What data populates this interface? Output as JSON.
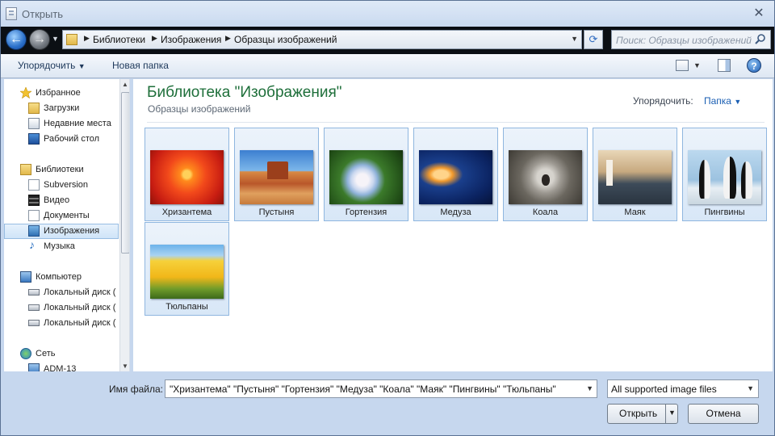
{
  "window": {
    "title": "Открыть"
  },
  "address": {
    "segments": [
      "Библиотеки",
      "Изображения",
      "Образцы изображений"
    ]
  },
  "search": {
    "placeholder": "Поиск: Образцы изображений"
  },
  "toolbar": {
    "organize_label": "Упорядочить",
    "new_folder_label": "Новая папка"
  },
  "nav": {
    "favorites": {
      "label": "Избранное",
      "items": [
        "Загрузки",
        "Недавние места",
        "Рабочий стол"
      ]
    },
    "libraries": {
      "label": "Библиотеки",
      "items": [
        "Subversion",
        "Видео",
        "Документы",
        "Изображения",
        "Музыка"
      ],
      "selected": "Изображения"
    },
    "computer": {
      "label": "Компьютер",
      "items": [
        "Локальный диск (",
        "Локальный диск (",
        "Локальный диск ("
      ]
    },
    "network": {
      "label": "Сеть",
      "items": [
        "ADM-13"
      ]
    }
  },
  "content": {
    "library_title": "Библиотека \"Изображения\"",
    "library_subtitle": "Образцы изображений",
    "arrange_label": "Упорядочить:",
    "arrange_value": "Папка",
    "items": [
      {
        "name": "Хризантема",
        "image": "chrysanthemum"
      },
      {
        "name": "Пустыня",
        "image": "desert"
      },
      {
        "name": "Гортензия",
        "image": "hydrangeas"
      },
      {
        "name": "Медуза",
        "image": "jellyfish"
      },
      {
        "name": "Коала",
        "image": "koala"
      },
      {
        "name": "Маяк",
        "image": "lighthouse"
      },
      {
        "name": "Пингвины",
        "image": "penguins"
      },
      {
        "name": "Тюльпаны",
        "image": "tulips"
      }
    ]
  },
  "footer": {
    "filename_label": "Имя файла:",
    "filename_value": "\"Хризантема\" \"Пустыня\" \"Гортензия\" \"Медуза\" \"Коала\" \"Маяк\" \"Пингвины\" \"Тюльпаны\"",
    "filter_value": "All supported image files",
    "open_label": "Открыть",
    "cancel_label": "Отмена"
  },
  "colors": {
    "accent_title": "#1e6f3a",
    "link_blue": "#1b5fb3",
    "selection_fill": "#d8e7f7",
    "selection_border": "#8fb6df"
  }
}
